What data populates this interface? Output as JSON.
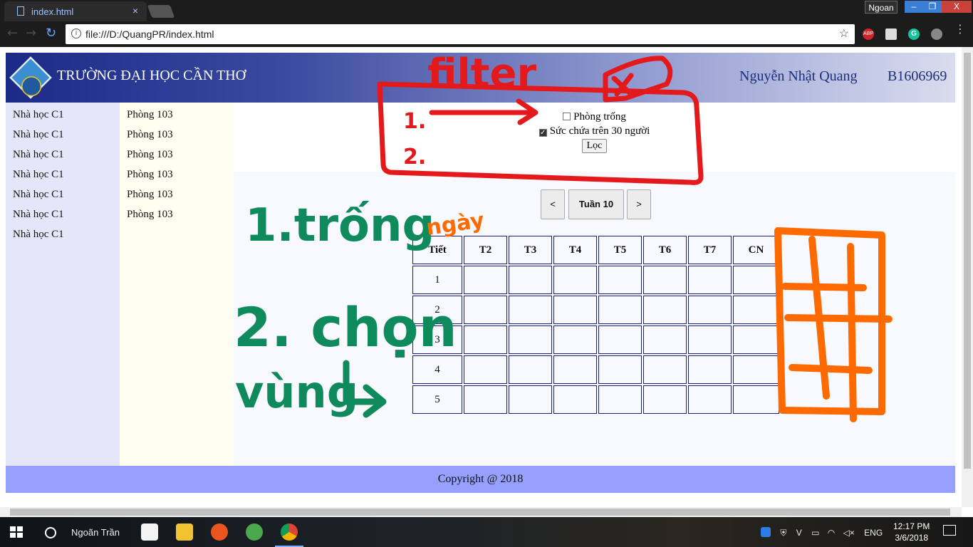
{
  "browser": {
    "tab_title": "index.html",
    "tab_close": "×",
    "profile": "Ngoan",
    "url": "file:///D:/QuangPR/index.html",
    "window_min": "‒",
    "window_max": "❐",
    "window_close": "X",
    "extensions": [
      "ABP",
      "cube",
      "G",
      "cat"
    ]
  },
  "header": {
    "school": "TRƯỜNG ĐẠI HỌC CẦN THƠ",
    "student_name": "Nguyễn Nhật Quang",
    "student_id": "B1606969"
  },
  "buildings": [
    "Nhà học C1",
    "Nhà học C1",
    "Nhà học C1",
    "Nhà học C1",
    "Nhà học C1",
    "Nhà học C1",
    "Nhà học C1"
  ],
  "rooms": [
    "Phòng 103",
    "Phòng 103",
    "Phòng 103",
    "Phòng 103",
    "Phòng 103",
    "Phòng 103"
  ],
  "filter": {
    "empty_room_label": "Phòng trống",
    "empty_room_checked": false,
    "capacity_label": "Sức chứa trên 30 người",
    "capacity_checked": true,
    "button": "Lọc"
  },
  "week_nav": {
    "prev": "<",
    "label": "Tuần 10",
    "next": ">"
  },
  "schedule": {
    "headers": [
      "Tiết",
      "T2",
      "T3",
      "T4",
      "T5",
      "T6",
      "T7",
      "CN"
    ],
    "periods": [
      "1",
      "2",
      "3",
      "4",
      "5"
    ]
  },
  "footer": "Copyright @ 2018",
  "annotations": {
    "filter_title": "filter",
    "step1_number": "1.",
    "step2_number": "2.",
    "note1": "1.trống",
    "note1_word": "ngày",
    "note2_line1": "2. chọn",
    "note2_line2": "vùng",
    "colors": {
      "red": "#e3191c",
      "green": "#0f8a5c",
      "orange": "#ff6a00"
    }
  },
  "taskbar": {
    "user": "Ngoãn Trần",
    "tray_lang": "ENG",
    "tray_v": "V",
    "time": "12:17 PM",
    "date": "3/6/2018"
  }
}
